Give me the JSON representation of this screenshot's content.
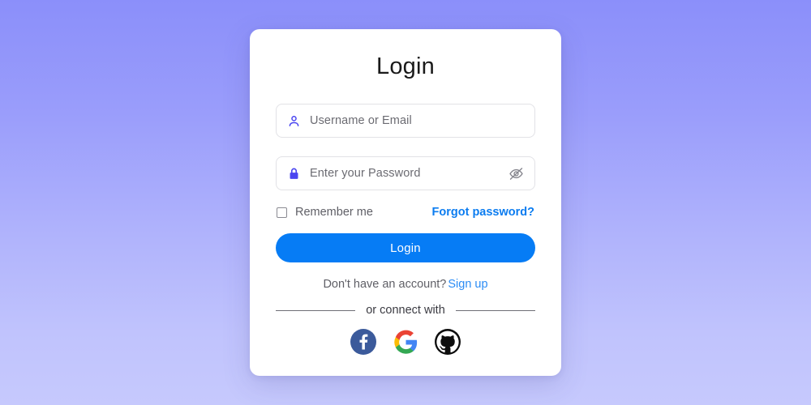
{
  "theme": {
    "background_gradient_top": "#8b8ffa",
    "background_gradient_bottom": "#c6c9fd",
    "card_background": "#ffffff",
    "primary_button_color": "#067cf5",
    "link_color": "#0b7cf0",
    "field_icon_color": "#4b46f0",
    "facebook_color": "#3b5a9b",
    "github_color": "#0d0d0d"
  },
  "card": {
    "title": "Login",
    "username_field": {
      "icon": "user-icon",
      "placeholder": "Username or Email",
      "value": ""
    },
    "password_field": {
      "icon": "lock-icon",
      "placeholder": "Enter your Password",
      "value": "",
      "toggle_icon": "eye-off-icon"
    },
    "remember_me": {
      "label": "Remember me",
      "checked": false
    },
    "forgot_password_label": "Forgot password?",
    "submit_label": "Login",
    "signup_prompt": "Don't have an account?",
    "signup_label": "Sign up",
    "divider_label": "or connect with",
    "social_buttons": [
      {
        "name": "facebook",
        "icon": "facebook-icon",
        "label": "Facebook"
      },
      {
        "name": "google",
        "icon": "google-icon",
        "label": "Google"
      },
      {
        "name": "github",
        "icon": "github-icon",
        "label": "GitHub"
      }
    ]
  }
}
